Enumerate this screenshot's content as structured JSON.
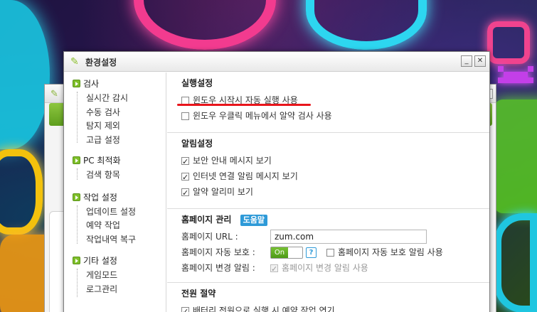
{
  "dialog": {
    "title": "환경설정",
    "minimize_label": "_",
    "close_label": "✕"
  },
  "nav": {
    "groups": [
      {
        "label": "검사",
        "items": [
          "실시간 감시",
          "수동 검사",
          "탐지 제외",
          "고급 설정"
        ]
      },
      {
        "label": "PC 최적화",
        "items": [
          "검색 항목"
        ]
      },
      {
        "label": "작업 설정",
        "items": [
          "업데이트 설정",
          "예약 작업",
          "작업내역 복구"
        ]
      },
      {
        "label": "기타 설정",
        "items": [
          "게임모드",
          "로그관리"
        ]
      }
    ]
  },
  "sections": {
    "run": {
      "title": "실행설정",
      "options": [
        {
          "label": "윈도우 시작시 자동 실행 사용",
          "checked": false
        },
        {
          "label": "윈도우 우클릭 메뉴에서 알약 검사 사용",
          "checked": false
        }
      ]
    },
    "alarm": {
      "title": "알림설정",
      "options": [
        {
          "label": "보안 안내 메시지 보기",
          "checked": true
        },
        {
          "label": "인터넷 연결 알림 메시지 보기",
          "checked": true
        },
        {
          "label": "알약 알리미 보기",
          "checked": true
        }
      ]
    },
    "homepage": {
      "title": "홈페이지 관리",
      "help_label": "도움말",
      "url_label": "홈페이지 URL :",
      "url_value": "zum.com",
      "protect_label": "홈페이지 자동 보호 :",
      "protect_toggle": "On",
      "help_icon": "?",
      "protect_alarm_label": "홈페이지 자동 보호 알림 사용",
      "protect_alarm_checked": false,
      "change_label": "홈페이지 변경 알림 :",
      "change_alarm_label": "홈페이지 변경 알림 사용",
      "change_alarm_checked": true
    },
    "power": {
      "title": "전원 절약",
      "options": [
        {
          "label": "배터리 전원으로 실행 시 예약 작업 연기",
          "checked": true
        }
      ]
    }
  },
  "colors": {
    "accent_green": "#7fbf2a",
    "help_blue": "#2e9ad8",
    "highlight_red": "#e8151b"
  }
}
